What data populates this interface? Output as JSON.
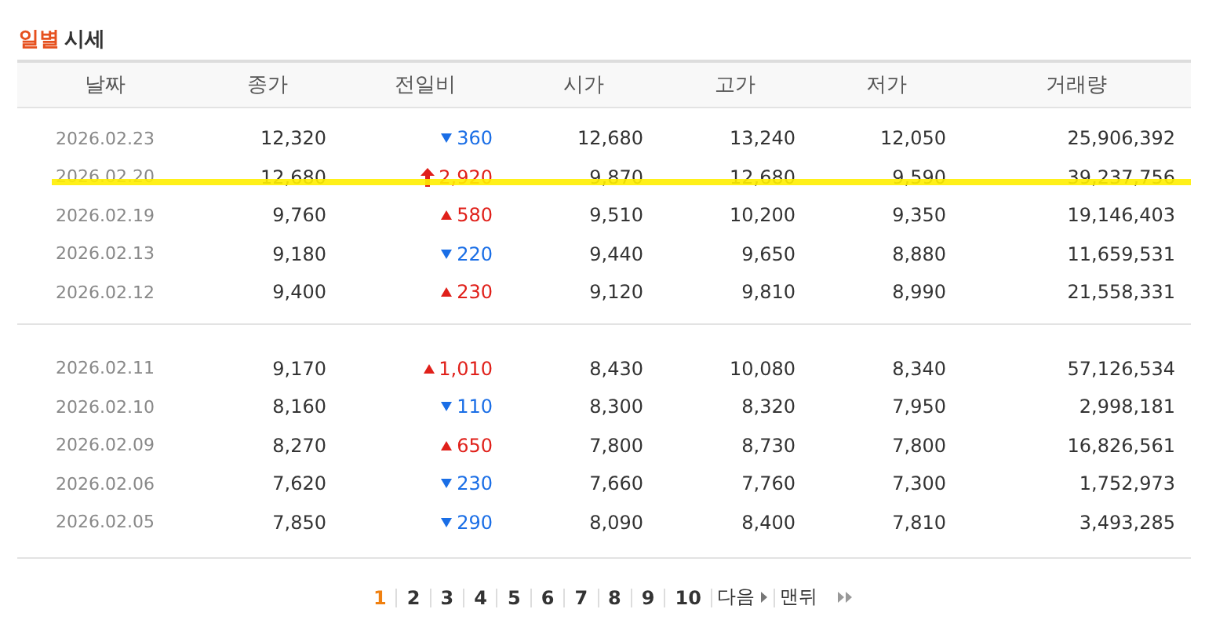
{
  "title": {
    "accent": "일별",
    "rest": "시세"
  },
  "table": {
    "columns": [
      "날짜",
      "종가",
      "전일비",
      "시가",
      "고가",
      "저가",
      "거래량"
    ],
    "groups": [
      {
        "rows": [
          {
            "date": "2026.02.23",
            "close": "12,320",
            "change": {
              "kind": "down",
              "value": "360"
            },
            "open": "12,680",
            "high": "13,240",
            "low": "12,050",
            "volume": "25,906,392",
            "highlighted": false
          },
          {
            "date": "2026.02.20",
            "close": "12,680",
            "change": {
              "kind": "upper_limit",
              "value": "2,920"
            },
            "open": "9,870",
            "high": "12,680",
            "low": "9,590",
            "volume": "39,237,756",
            "highlighted": true
          },
          {
            "date": "2026.02.19",
            "close": "9,760",
            "change": {
              "kind": "up",
              "value": "580"
            },
            "open": "9,510",
            "high": "10,200",
            "low": "9,350",
            "volume": "19,146,403",
            "highlighted": false
          },
          {
            "date": "2026.02.13",
            "close": "9,180",
            "change": {
              "kind": "down",
              "value": "220"
            },
            "open": "9,440",
            "high": "9,650",
            "low": "8,880",
            "volume": "11,659,531",
            "highlighted": false
          },
          {
            "date": "2026.02.12",
            "close": "9,400",
            "change": {
              "kind": "up",
              "value": "230"
            },
            "open": "9,120",
            "high": "9,810",
            "low": "8,990",
            "volume": "21,558,331",
            "highlighted": false
          }
        ]
      },
      {
        "rows": [
          {
            "date": "2026.02.11",
            "close": "9,170",
            "change": {
              "kind": "up",
              "value": "1,010"
            },
            "open": "8,430",
            "high": "10,080",
            "low": "8,340",
            "volume": "57,126,534",
            "highlighted": false
          },
          {
            "date": "2026.02.10",
            "close": "8,160",
            "change": {
              "kind": "down",
              "value": "110"
            },
            "open": "8,300",
            "high": "8,320",
            "low": "7,950",
            "volume": "2,998,181",
            "highlighted": false
          },
          {
            "date": "2026.02.09",
            "close": "8,270",
            "change": {
              "kind": "up",
              "value": "650"
            },
            "open": "7,800",
            "high": "8,730",
            "low": "7,800",
            "volume": "16,826,561",
            "highlighted": false
          },
          {
            "date": "2026.02.06",
            "close": "7,620",
            "change": {
              "kind": "down",
              "value": "230"
            },
            "open": "7,660",
            "high": "7,760",
            "low": "7,300",
            "volume": "1,752,973",
            "highlighted": false
          },
          {
            "date": "2026.02.05",
            "close": "7,850",
            "change": {
              "kind": "down",
              "value": "290"
            },
            "open": "8,090",
            "high": "8,400",
            "low": "7,810",
            "volume": "3,493,285",
            "highlighted": false
          }
        ]
      }
    ]
  },
  "pagination": {
    "pages": [
      {
        "label": "1",
        "selected": true
      },
      {
        "label": "2",
        "selected": false
      },
      {
        "label": "3",
        "selected": false
      },
      {
        "label": "4",
        "selected": false
      },
      {
        "label": "5",
        "selected": false
      },
      {
        "label": "6",
        "selected": false
      },
      {
        "label": "7",
        "selected": false
      },
      {
        "label": "8",
        "selected": false
      },
      {
        "label": "9",
        "selected": false
      },
      {
        "label": "10",
        "selected": false
      }
    ],
    "next": "다음",
    "last": "맨뒤"
  }
}
